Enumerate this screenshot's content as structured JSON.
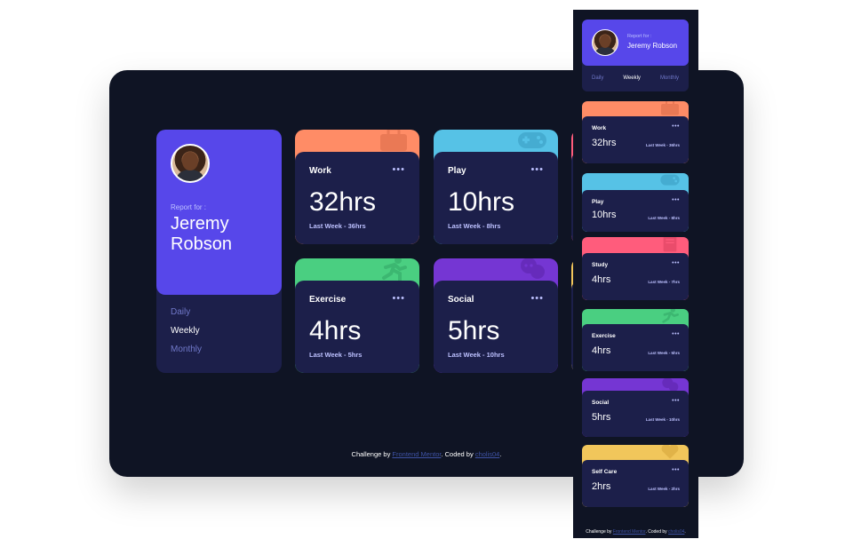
{
  "profile": {
    "report_for": "Report for :",
    "name_line1": "Jeremy",
    "name_line2": "Robson",
    "mobile_report_for": "Report for :",
    "mobile_name": "Jeremy Robson",
    "periods": [
      "Daily",
      "Weekly",
      "Monthly"
    ],
    "active_period": "Weekly"
  },
  "cards": [
    {
      "title": "Work",
      "hours": "32hrs",
      "previous": "Last Week - 36hrs",
      "color": "#ff8c66",
      "icon": "briefcase-icon"
    },
    {
      "title": "Play",
      "hours": "10hrs",
      "previous": "Last Week - 8hrs",
      "color": "#56c2e6",
      "icon": "gamepad-icon"
    },
    {
      "title": "Study",
      "hours": "4hrs",
      "previous": "Last Week - 7hrs",
      "color": "#ff5c7c",
      "icon": "book-icon"
    },
    {
      "title": "Exercise",
      "hours": "4hrs",
      "previous": "Last Week - 5hrs",
      "color": "#4acf81",
      "icon": "running-icon"
    },
    {
      "title": "Social",
      "hours": "5hrs",
      "previous": "Last Week - 10hrs",
      "color": "#7536d3",
      "icon": "chat-icon"
    },
    {
      "title": "Self Care",
      "hours": "2hrs",
      "previous": "Last Week - 2hrs",
      "color": "#f1c65b",
      "icon": "heart-icon"
    }
  ],
  "more_label": "•••",
  "footer": {
    "prefix": "Challenge by ",
    "link1": "Frontend Mentor",
    "middle": ". Coded by ",
    "link2": "cholis04",
    "suffix": "."
  },
  "colors": {
    "background": "#0f1424",
    "card": "#1c1f4a",
    "accent": "#5747ea",
    "muted": "#bdc1ff"
  }
}
